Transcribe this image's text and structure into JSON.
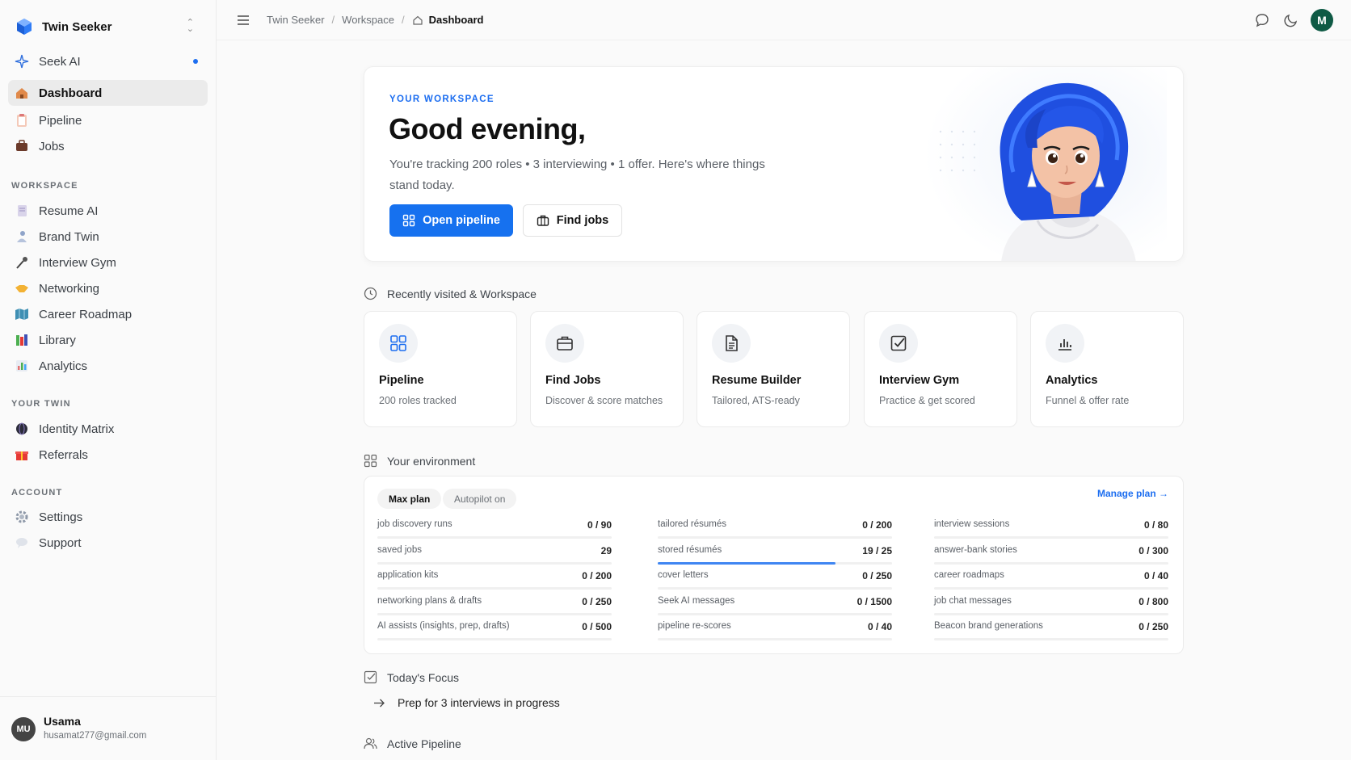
{
  "app": {
    "name": "Twin Seeker"
  },
  "sidebar": {
    "top_items": [
      {
        "label": "Seek AI",
        "icon": "sparkle-icon"
      },
      {
        "label": "Dashboard",
        "icon": "house-icon"
      },
      {
        "label": "Pipeline",
        "icon": "clipboard-icon"
      },
      {
        "label": "Jobs",
        "icon": "briefcase-icon"
      }
    ],
    "workspace_label": "WORKSPACE",
    "workspace_items": [
      {
        "label": "Resume AI",
        "icon": "document-icon"
      },
      {
        "label": "Brand Twin",
        "icon": "person-icon"
      },
      {
        "label": "Interview Gym",
        "icon": "microphone-icon"
      },
      {
        "label": "Networking",
        "icon": "handshake-icon"
      },
      {
        "label": "Career Roadmap",
        "icon": "map-icon"
      },
      {
        "label": "Library",
        "icon": "books-icon"
      },
      {
        "label": "Analytics",
        "icon": "bar-chart-icon"
      }
    ],
    "twin_label": "YOUR TWIN",
    "twin_items": [
      {
        "label": "Identity Matrix",
        "icon": "globe-icon"
      },
      {
        "label": "Referrals",
        "icon": "gift-icon"
      }
    ],
    "account_label": "ACCOUNT",
    "account_items": [
      {
        "label": "Settings",
        "icon": "gear-icon"
      },
      {
        "label": "Support",
        "icon": "speech-bubble-icon"
      }
    ],
    "user": {
      "initials": "MU",
      "name": "Usama",
      "email": "husamat277@gmail.com"
    }
  },
  "topbar": {
    "breadcrumbs": [
      "Twin Seeker",
      "Workspace",
      "Dashboard"
    ],
    "avatar_initial": "M"
  },
  "hero": {
    "eyebrow": "YOUR WORKSPACE",
    "greeting": "Good evening,",
    "subtitle": "You're tracking 200 roles • 3 interviewing • 1 offer. Here's where things stand today.",
    "primary_button": "Open pipeline",
    "secondary_button": "Find jobs"
  },
  "recent": {
    "heading": "Recently visited & Workspace",
    "cards": [
      {
        "title": "Pipeline",
        "subtitle": "200 roles tracked",
        "icon": "grid-icon"
      },
      {
        "title": "Find Jobs",
        "subtitle": "Discover & score matches",
        "icon": "briefcase-icon"
      },
      {
        "title": "Resume Builder",
        "subtitle": "Tailored, ATS-ready",
        "icon": "document-icon"
      },
      {
        "title": "Interview Gym",
        "subtitle": "Practice & get scored",
        "icon": "checkbox-icon"
      },
      {
        "title": "Analytics",
        "subtitle": "Funnel & offer rate",
        "icon": "bar-chart-icon"
      }
    ]
  },
  "environment": {
    "heading": "Your environment",
    "plan_chip": "Max plan",
    "autopilot_chip": "Autopilot on",
    "manage_link": "Manage plan →",
    "columns": [
      [
        {
          "label": "job discovery runs",
          "value": "0 / 90",
          "fill": 0
        },
        {
          "label": "saved jobs",
          "value": "29",
          "fill": 0
        },
        {
          "label": "application kits",
          "value": "0 / 200",
          "fill": 0
        },
        {
          "label": "networking plans & drafts",
          "value": "0 / 250",
          "fill": 0
        },
        {
          "label": "AI assists (insights, prep, drafts)",
          "value": "0 / 500",
          "fill": 0
        }
      ],
      [
        {
          "label": "tailored résumés",
          "value": "0 / 200",
          "fill": 0
        },
        {
          "label": "stored résumés",
          "value": "19 / 25",
          "fill": 0.76
        },
        {
          "label": "cover letters",
          "value": "0 / 250",
          "fill": 0
        },
        {
          "label": "Seek AI messages",
          "value": "0 / 1500",
          "fill": 0
        },
        {
          "label": "pipeline re-scores",
          "value": "0 / 40",
          "fill": 0
        }
      ],
      [
        {
          "label": "interview sessions",
          "value": "0 / 80",
          "fill": 0
        },
        {
          "label": "answer-bank stories",
          "value": "0 / 300",
          "fill": 0
        },
        {
          "label": "career roadmaps",
          "value": "0 / 40",
          "fill": 0
        },
        {
          "label": "job chat messages",
          "value": "0 / 800",
          "fill": 0
        },
        {
          "label": "Beacon brand generations",
          "value": "0 / 250",
          "fill": 0
        }
      ]
    ]
  },
  "focus": {
    "heading": "Today's Focus",
    "items": [
      "Prep for 3 interviews in progress"
    ]
  },
  "active_pipeline": {
    "heading": "Active Pipeline"
  },
  "colors": {
    "accent": "#1671ef",
    "avatar_green": "#0f5a45"
  }
}
